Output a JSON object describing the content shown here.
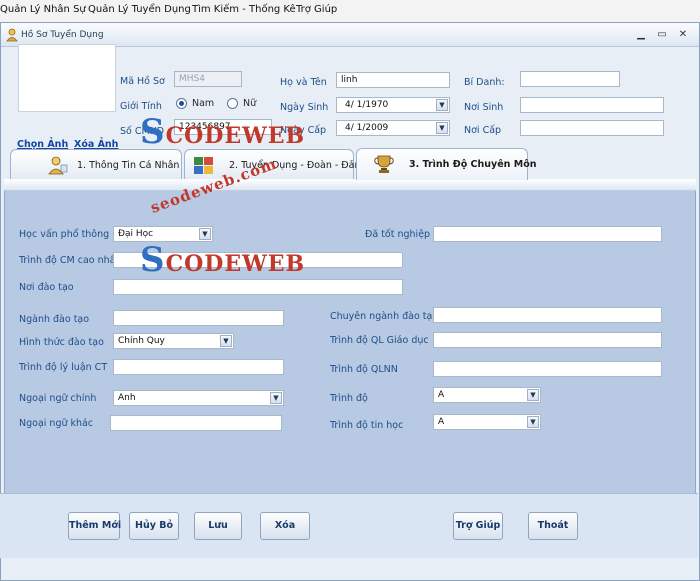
{
  "menubar": {
    "items": [
      "Quản Lý Nhân Sự",
      "Quản Lý Tuyển Dụng",
      "Tìm Kiếm - Thống Kê",
      "Trợ Giúp"
    ]
  },
  "window": {
    "title": "Hồ Sơ Tuyển Dụng",
    "controls": [
      "minimize-icon",
      "restore-icon",
      "close-icon"
    ]
  },
  "profile": {
    "choose_photo": "Chọn Ảnh",
    "delete_photo": "Xóa Ảnh",
    "ma_ho_so_label": "Mã Hồ Sơ",
    "ma_ho_so_value": "MHS4",
    "gioi_tinh_label": "Giới Tính",
    "nam_label": "Nam",
    "nu_label": "Nữ",
    "selected_gender": "Nam",
    "so_cmnd_label": "Số CMND",
    "so_cmnd_value": "123456897",
    "ho_ten_label": "Họ và Tên",
    "ho_ten_value": "linh",
    "ngay_sinh_label": "Ngày Sinh",
    "ngay_sinh_value": "4/ 1/1970",
    "ngay_cap_label": "Ngày Cấp",
    "ngay_cap_value": "4/ 1/2009",
    "bi_danh_label": "Bí Danh:",
    "bi_danh_value": "",
    "noi_sinh_label": "Nơi Sinh",
    "noi_sinh_value": "",
    "noi_cap_label": "Nơi Cấp",
    "noi_cap_value": ""
  },
  "tabs": [
    {
      "label": "1. Thông Tin Cá Nhân",
      "active": false
    },
    {
      "label": "2. Tuyển Dụng - Đoàn - Đảng",
      "active": false
    },
    {
      "label": "3. Trình Độ Chuyên Môn",
      "active": true
    }
  ],
  "education": {
    "hoc_van_label": "Học vấn phổ thông",
    "hoc_van_value": "Đại Học",
    "da_tot_nghiep_label": "Đã tốt nghiệp",
    "da_tot_nghiep_value": "",
    "trinh_do_cm_label": "Trình độ CM cao nhất",
    "trinh_do_cm_value": "",
    "noi_dao_tao_label": "Nơi đào tạo",
    "noi_dao_tao_value": "",
    "nganh_dao_tao_label": "Ngành đào tạo",
    "nganh_dao_tao_value": "",
    "chuyen_nganh_label": "Chuyên ngành đào tạo",
    "chuyen_nganh_value": "",
    "hinh_thuc_label": "Hình thức đào tạo",
    "hinh_thuc_value": "Chính Quy",
    "ql_giao_duc_label": "Trình độ QL Giáo dục",
    "ql_giao_duc_value": "",
    "ly_luan_label": "Trình độ lý luận CT",
    "ly_luan_value": "",
    "qlnn_label": "Trình độ QLNN",
    "qlnn_value": "",
    "ngoai_ngu_chinh_label": "Ngoại ngữ chính",
    "ngoai_ngu_chinh_value": "Anh",
    "trinh_do_label": "Trình độ",
    "trinh_do_value": "A",
    "ngoai_ngu_khac_label": "Ngoại ngữ khác",
    "ngoai_ngu_khac_value": "",
    "tin_hoc_label": "Trình độ tin học",
    "tin_hoc_value": "A"
  },
  "buttons": {
    "them_moi": "Thêm Mới",
    "huy_bo": "Hủy Bỏ",
    "luu": "Lưu",
    "xoa": "Xóa",
    "tro_giup": "Trợ Giúp",
    "thoat": "Thoát"
  },
  "watermark": {
    "brand_s": "S",
    "brand_rest": "CODEWEB",
    "url": "seodeweb.com"
  },
  "colors": {
    "label_blue": "#1d4e8a",
    "panel_bg": "#b8c9e3",
    "watermark_red": "#c0392b",
    "watermark_blue": "#2e6fc2"
  }
}
